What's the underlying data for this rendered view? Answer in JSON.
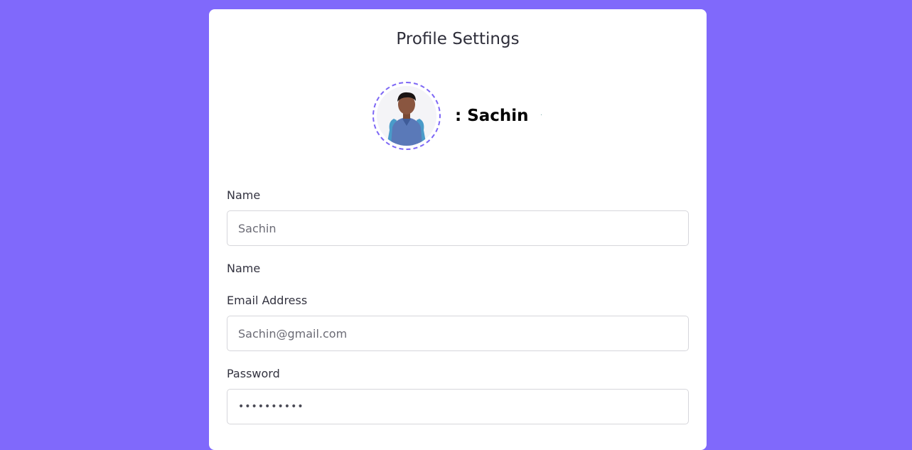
{
  "page": {
    "title": "Profile Settings"
  },
  "profile": {
    "display_name": ": Sachin",
    "avatar_icon": "user-photo-avatar"
  },
  "form": {
    "name_label": "Name",
    "name_value": "Sachin",
    "secondary_name_label": "Name",
    "email_label": "Email Address",
    "email_value": "Sachin@gmail.com",
    "password_label": "Password",
    "password_value": "••••••••••"
  },
  "colors": {
    "background": "#8069fb",
    "card": "#ffffff",
    "accent": "#7d67f5"
  }
}
